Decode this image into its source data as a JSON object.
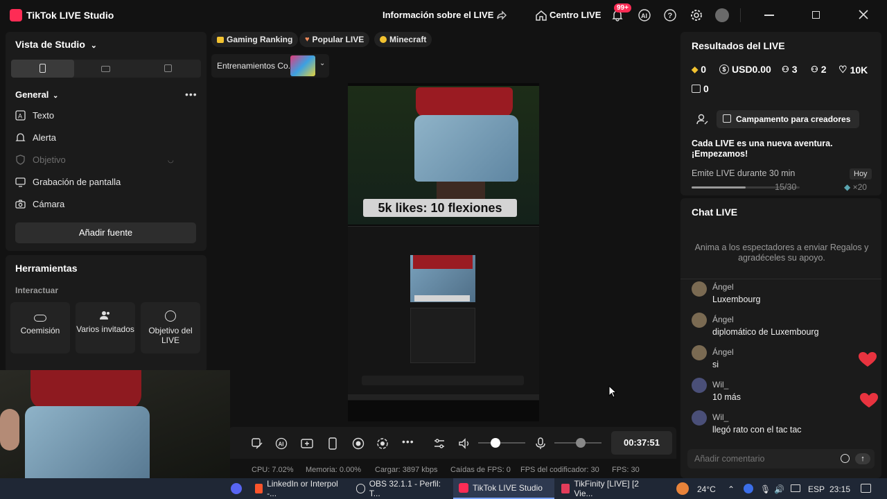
{
  "titlebar": {
    "app_name": "TikTok LIVE Studio",
    "live_info": "Información sobre el LIVE",
    "center_live": "Centro LIVE",
    "notif_badge": "99+"
  },
  "studio": {
    "view_label": "Vista de Studio",
    "section_general": "General",
    "sources": [
      "Texto",
      "Alerta",
      "Objetivo",
      "Grabación de pantalla",
      "Cámara"
    ],
    "add_source": "Añadir fuente"
  },
  "tools": {
    "title": "Herramientas",
    "subtitle": "Interactuar",
    "cards": [
      "Coemisión",
      "Varios invitados",
      "Objetivo del LIVE"
    ]
  },
  "chips": [
    "Gaming Ranking",
    "Popular LIVE",
    "Minecraft"
  ],
  "room_selector": "Entrenamientos Co...",
  "preview": {
    "banner": "5k likes: 10 flexiones"
  },
  "controls": {
    "timer": "00:37:51"
  },
  "status": {
    "cpu": "CPU: 7.02%",
    "memory": "Memoria: 0.00%",
    "upload": "Cargar: 3897 kbps",
    "fps_drops": "Caídas de FPS: 0",
    "encoder_fps": "FPS del codificador: 30",
    "fps": "FPS: 30"
  },
  "results": {
    "title": "Resultados del LIVE",
    "diamonds": "0",
    "usd": "USD0.00",
    "viewers": "3",
    "followers": "2",
    "likes": "10K",
    "gifts": "0",
    "camp_button": "Campamento para creadores",
    "adventure": "Cada LIVE es una nueva aventura. ¡Empezamos!",
    "task_label": "Emite LIVE durante 30 min",
    "task_badge": "Hoy",
    "task_progress": "15/30",
    "task_progress_value": 0.5,
    "task_reward": "×20"
  },
  "chat": {
    "title": "Chat LIVE",
    "hint": "Anima a los espectadores a enviar Regalos y agradéceles su apoyo.",
    "messages": [
      {
        "name": "Ángel",
        "text": "Luxembourg"
      },
      {
        "name": "Ángel",
        "text": "diplomático de Luxembourg"
      },
      {
        "name": "Ángel",
        "text": "si"
      },
      {
        "name": "Wil_",
        "text": "10 más"
      },
      {
        "name": "Wil_",
        "text": "llegó rato con el tac tac"
      }
    ],
    "placeholder": "Añadir comentario"
  },
  "taskbar": {
    "apps": [
      "LinkedIn or Interpol -...",
      "OBS 32.1.1 - Perfil: T...",
      "TikTok LIVE Studio",
      "TikFinity [LIVE] [2 Vie..."
    ],
    "weather": "24°C",
    "lang": "ESP",
    "time": "23:15"
  }
}
